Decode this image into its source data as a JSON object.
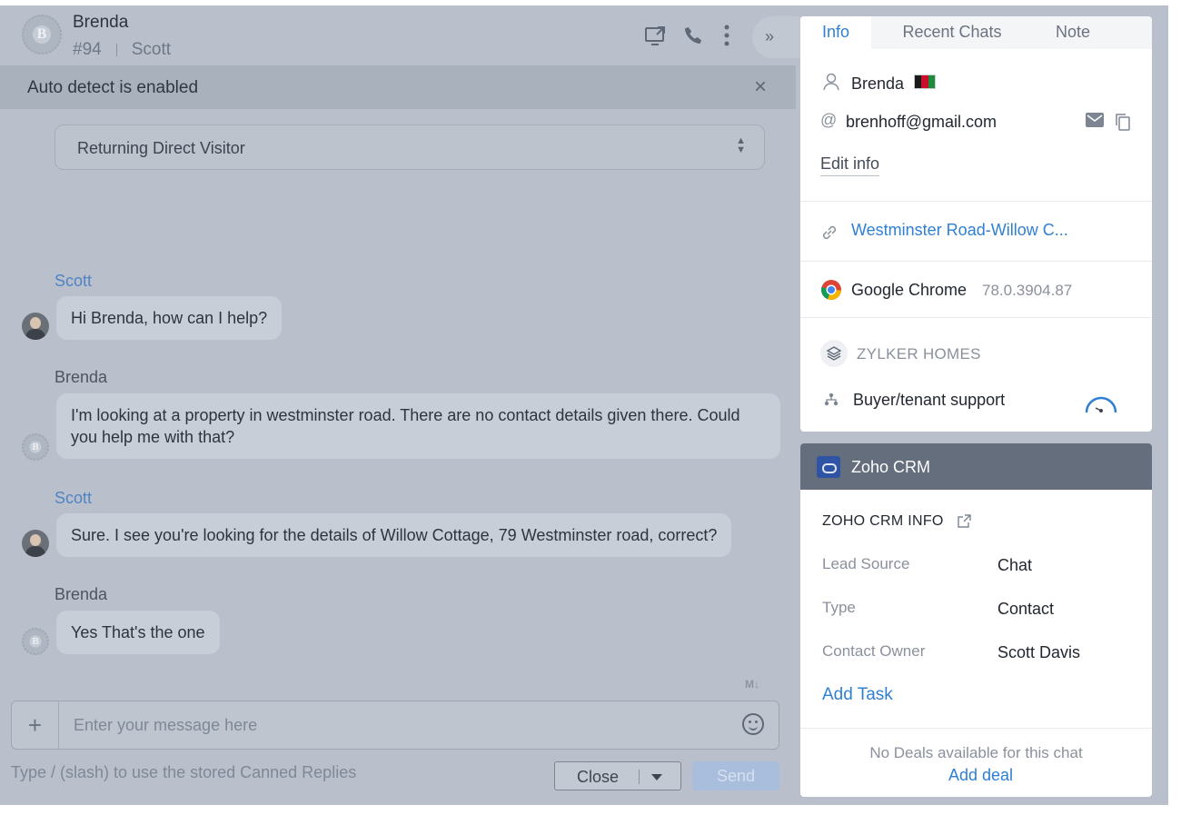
{
  "chat_header": {
    "visitor_name": "Brenda",
    "chat_id": "#94",
    "agent_name": "Scott",
    "icons": [
      "screen-share-icon",
      "phone-icon",
      "more-vertical-icon",
      "double-chevron-right-icon"
    ]
  },
  "banner": {
    "text": "Auto detect is enabled"
  },
  "visitor_type_select": {
    "value": "Returning Direct Visitor"
  },
  "messages": [
    {
      "sender": "Scott",
      "role": "agent",
      "text": "Hi Brenda, how can I help?"
    },
    {
      "sender": "Brenda",
      "role": "visitor",
      "text": "I'm looking at a property in westminster road. There are no contact details given there. Could you help me with that?"
    },
    {
      "sender": "Scott",
      "role": "agent",
      "text": "Sure. I see you're looking for the details of Willow Cottage, 79 Westminster road, correct?"
    },
    {
      "sender": "Brenda",
      "role": "visitor",
      "text": "Yes That's the one"
    }
  ],
  "composer": {
    "markdown_label": "M↓",
    "placeholder": "Enter your message here",
    "hint": "Type / (slash) to use the stored Canned Replies",
    "close_label": "Close",
    "send_label": "Send"
  },
  "info_panel": {
    "tabs": [
      "Info",
      "Recent Chats",
      "Note"
    ],
    "active_tab": "Info",
    "name": "Brenda",
    "email": "brenhoff@gmail.com",
    "edit_label": "Edit info",
    "page_link": "Westminster Road-Willow C...",
    "browser": "Google Chrome",
    "browser_version": "78.0.3904.87",
    "brand": "ZYLKER HOMES",
    "department": "Buyer/tenant support",
    "accent_color": "#2f7fd3"
  },
  "crm_panel": {
    "title": "Zoho CRM",
    "section_title": "ZOHO CRM INFO",
    "fields": [
      {
        "key": "Lead Source",
        "value": "Chat"
      },
      {
        "key": "Type",
        "value": "Contact"
      },
      {
        "key": "Contact Owner",
        "value": "Scott Davis"
      }
    ],
    "add_task_label": "Add Task",
    "no_deals_text": "No Deals available for this chat",
    "add_deal_label": "Add deal"
  }
}
